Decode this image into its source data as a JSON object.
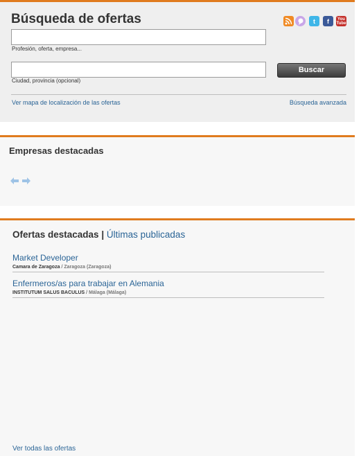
{
  "search": {
    "title": "Búsqueda de ofertas",
    "field1_hint": "Profesión, oferta, empresa...",
    "field2_hint": "Ciudad, provincia (opcional)",
    "button_label": "Buscar",
    "map_link": "Ver mapa de localización de las ofertas",
    "advanced_link": "Búsqueda avanzada",
    "social_icons": [
      "rss-icon",
      "chat-icon",
      "twitter-icon",
      "facebook-icon",
      "youtube-icon"
    ]
  },
  "featured_companies": {
    "title": "Empresas destacadas"
  },
  "offers": {
    "tab_active": "Ofertas destacadas",
    "separator": "|",
    "tab_other": "Últimas publicadas",
    "items": [
      {
        "title": "Market Developer",
        "company": "Camara de Zaragoza",
        "sep": "/",
        "location": "Zaragoza (Zaragoza)"
      },
      {
        "title": "Enfermeros/as para trabajar en Alemania",
        "company": "INSTITUTUM SALUS BACULUS",
        "sep": "/",
        "location": "Málaga (Málaga)"
      }
    ],
    "see_all": "Ver todas las ofertas"
  },
  "colors": {
    "accent": "#e07b1e",
    "link": "#2a6496"
  }
}
